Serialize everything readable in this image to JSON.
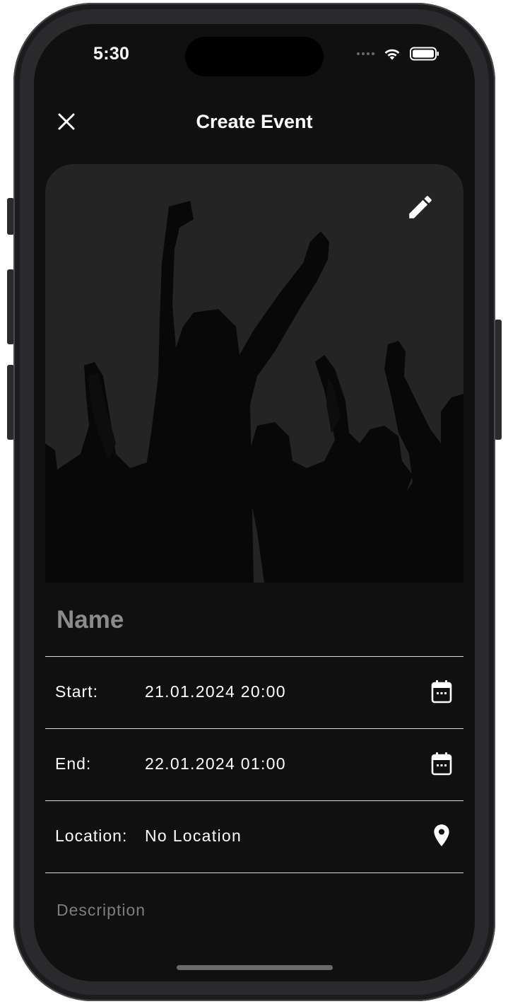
{
  "status_bar": {
    "time": "5:30"
  },
  "header": {
    "title": "Create Event",
    "close_icon": "close-icon"
  },
  "cover": {
    "edit_icon": "pencil-icon"
  },
  "form": {
    "name_placeholder": "Name",
    "name_value": "",
    "start": {
      "label": "Start:",
      "value": "21.01.2024 20:00",
      "icon": "calendar-icon"
    },
    "end": {
      "label": "End:",
      "value": "22.01.2024 01:00",
      "icon": "calendar-icon"
    },
    "location": {
      "label": "Location:",
      "value": "No Location",
      "icon": "location-pin-icon"
    },
    "description_placeholder": "Description",
    "description_value": ""
  },
  "colors": {
    "background": "#101010",
    "card": "#242424",
    "divider": "#d9d9d9",
    "placeholder": "#8b8b8b",
    "text": "#ffffff"
  }
}
